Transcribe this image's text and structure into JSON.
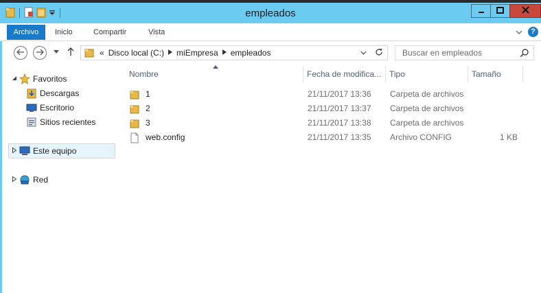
{
  "window": {
    "title": "empleados"
  },
  "qat": {
    "icons": [
      "folder-icon",
      "properties-icon",
      "new-folder-icon",
      "customize-qat-icon"
    ]
  },
  "caption": {
    "minimize": "minimize-icon",
    "maximize": "maximize-icon",
    "close": "close-icon"
  },
  "ribbon": {
    "tabs": [
      {
        "label": "Archivo",
        "active": true
      },
      {
        "label": "Inicio"
      },
      {
        "label": "Compartir"
      },
      {
        "label": "Vista"
      }
    ]
  },
  "navbar": {
    "address": {
      "prefix": "«",
      "crumbs": [
        "Disco local (C:)",
        "miEmpresa",
        "empleados"
      ]
    },
    "search": {
      "placeholder": "Buscar en empleados"
    }
  },
  "navpane": {
    "items": [
      {
        "label": "Favoritos",
        "icon": "star-icon",
        "level": 0
      },
      {
        "label": "Descargas",
        "icon": "downloads-icon",
        "level": 1
      },
      {
        "label": "Escritorio",
        "icon": "desktop-icon",
        "level": 1
      },
      {
        "label": "Sitios recientes",
        "icon": "recent-places-icon",
        "level": 1
      },
      {
        "label": "Este equipo",
        "icon": "computer-icon",
        "level": 0,
        "selected": true
      },
      {
        "label": "Red",
        "icon": "network-icon",
        "level": 0
      }
    ]
  },
  "content": {
    "columns": [
      "Nombre",
      "Fecha de modifica...",
      "Tipo",
      "Tamaño"
    ],
    "files": [
      {
        "name": "1",
        "date": "21/11/2017 13:36",
        "type": "Carpeta de archivos",
        "size": "",
        "icon": "folder-icon"
      },
      {
        "name": "2",
        "date": "21/11/2017 13:37",
        "type": "Carpeta de archivos",
        "size": "",
        "icon": "folder-icon"
      },
      {
        "name": "3",
        "date": "21/11/2017 13:38",
        "type": "Carpeta de archivos",
        "size": "",
        "icon": "folder-icon"
      },
      {
        "name": "web.config",
        "date": "21/11/2017 13:35",
        "type": "Archivo CONFIG",
        "size": "1 KB",
        "icon": "file-icon"
      }
    ]
  },
  "colors": {
    "titlebar": "#6ccbf0",
    "accent": "#1979ca",
    "close": "#c9483c",
    "selection": "#e5f3fb"
  }
}
